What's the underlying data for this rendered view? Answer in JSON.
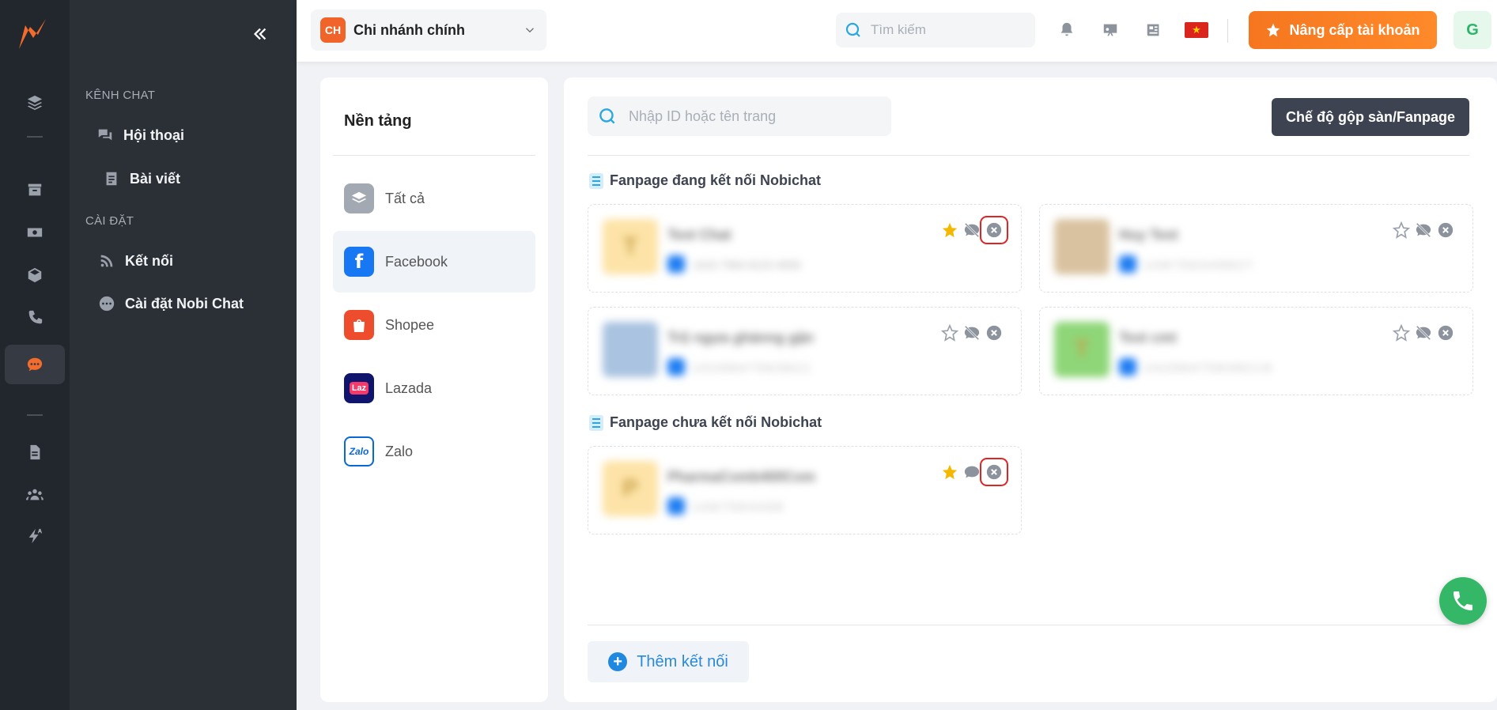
{
  "menu": {
    "section_chat": "KÊNH CHAT",
    "item_conversations": "Hội thoại",
    "item_posts": "Bài viết",
    "section_settings": "CÀI ĐẶT",
    "item_connections": "Kết nối",
    "item_nobichat_settings": "Cài đặt Nobi Chat"
  },
  "header": {
    "branch_badge": "CH",
    "branch_name": "Chi nhánh chính",
    "search_placeholder": "Tìm kiếm",
    "upgrade_label": "Nâng cấp tài khoản",
    "avatar_initial": "G",
    "flag_star": "★"
  },
  "platforms": {
    "title": "Nền tảng",
    "items": [
      {
        "label": "Tất cả",
        "color": "#9aa1ab"
      },
      {
        "label": "Facebook",
        "color": "#1877f2"
      },
      {
        "label": "Shopee",
        "color": "#ee4d2d"
      },
      {
        "label": "Lazada",
        "color": "#0f146d"
      },
      {
        "label": "Zalo",
        "color": "#ffffff"
      }
    ],
    "lazada_glyph": "Laz",
    "zalo_glyph": "Zalo"
  },
  "main": {
    "search_placeholder": "Nhập ID hoặc tên trang",
    "mode_button": "Chế độ gộp sàn/Fanpage",
    "section_connected": "Fanpage đang kết nối Nobichat",
    "section_not_connected": "Fanpage chưa kết nối Nobichat",
    "add_label": "Thêm kết nối",
    "add_glyph": "+"
  },
  "connected_pages": [
    {
      "avatar_letter": "T",
      "avatar_color": "#fde3a7",
      "name": "Test Chat",
      "page_id": "1015 7564 8123 4509",
      "starred": true,
      "highlight_close": true
    },
    {
      "avatar_letter": "",
      "avatar_color": "#d9c2a0",
      "name": "Huy Test",
      "page_id": "1 0 8 7 5 6 3 4 9 8 2 7",
      "starred": false,
      "highlight_close": false
    },
    {
      "avatar_letter": "",
      "avatar_color": "#a9c3e0",
      "name": "Trộ ngựa ghánng gặn",
      "page_id": "1 0 2 9 8 4 7 5 6 3 8 2 1",
      "starred": false,
      "highlight_close": false
    },
    {
      "avatar_letter": "T",
      "avatar_color": "#8ed678",
      "name": "Test cmt",
      "page_id": "1 0 2 9 8 4 7 5 6 3 8 2 1 9",
      "starred": false,
      "highlight_close": false
    }
  ],
  "unconnected_pages": [
    {
      "avatar_letter": "P",
      "avatar_color": "#fde3a7",
      "name": "PharmaComb400Com",
      "page_id": "1 0 8 7 5 6 3 4 9 8",
      "starred": true,
      "highlight_close": true
    }
  ],
  "colors": {
    "accent": "#f36c2c",
    "star_on": "#f5b800",
    "star_off": "#9aa1ab",
    "highlight": "#e02424"
  }
}
